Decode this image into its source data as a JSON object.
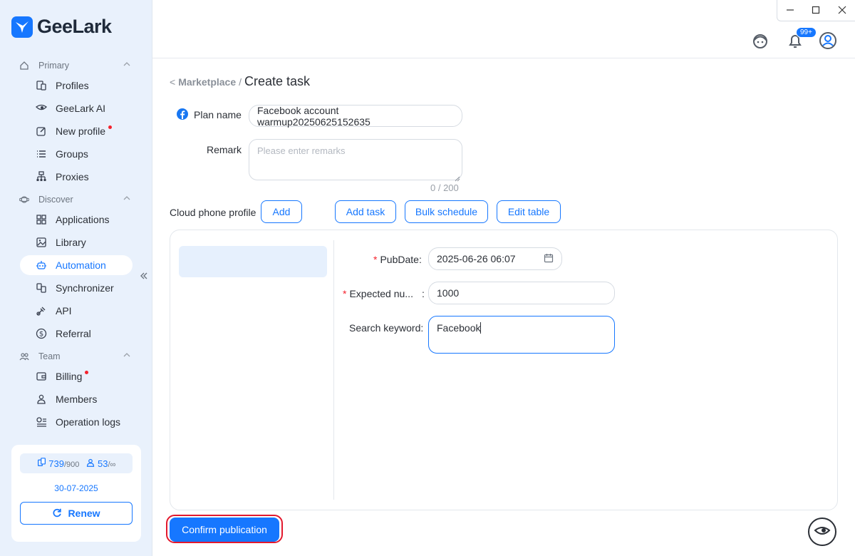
{
  "app": {
    "name": "GeeLark",
    "colors": {
      "accent": "#1677ff",
      "sidebar_bg": "#e9f1fc",
      "danger": "#f5222d"
    }
  },
  "sidebar": {
    "sections": [
      {
        "title": "Primary",
        "icon": "home-icon",
        "items": [
          {
            "label": "Profiles",
            "icon": "profiles-icon"
          },
          {
            "label": "GeeLark AI",
            "icon": "ai-eye-icon"
          },
          {
            "label": "New profile",
            "icon": "edit-icon",
            "dot": true
          },
          {
            "label": "Groups",
            "icon": "list-icon"
          },
          {
            "label": "Proxies",
            "icon": "network-icon"
          }
        ]
      },
      {
        "title": "Discover",
        "icon": "planet-icon",
        "items": [
          {
            "label": "Applications",
            "icon": "grid-icon"
          },
          {
            "label": "Library",
            "icon": "image-library-icon"
          },
          {
            "label": "Automation",
            "icon": "robot-icon",
            "active": true
          },
          {
            "label": "Synchronizer",
            "icon": "sync-icon"
          },
          {
            "label": "API",
            "icon": "api-icon"
          },
          {
            "label": "Referral",
            "icon": "dollar-icon"
          }
        ]
      },
      {
        "title": "Team",
        "icon": "team-icon",
        "items": [
          {
            "label": "Billing",
            "icon": "wallet-icon",
            "dot": true
          },
          {
            "label": "Members",
            "icon": "user-icon"
          },
          {
            "label": "Operation logs",
            "icon": "logs-icon"
          }
        ]
      }
    ],
    "quota": {
      "phones_used": "739",
      "phones_total": "/900",
      "members_used": "53",
      "members_total": "/∞",
      "expiry_date": "30-07-2025",
      "renew_label": "Renew"
    }
  },
  "topbar": {
    "notification_badge": "99+"
  },
  "breadcrumb": {
    "back": "<",
    "parent": "Marketplace",
    "separator": "/",
    "current": "Create task"
  },
  "form": {
    "plan_name_label": "Plan name",
    "plan_name_value": "Facebook account warmup20250625152635",
    "remark_label": "Remark",
    "remark_placeholder": "Please enter remarks",
    "remark_counter": "0 / 200",
    "cloud_phone_label": "Cloud phone profile",
    "add_label": "Add",
    "add_task_label": "Add task",
    "bulk_schedule_label": "Bulk schedule",
    "edit_table_label": "Edit table"
  },
  "task_params": {
    "pubdate_label": "PubDate",
    "pubdate_value": "2025-06-26 06:07",
    "expected_label": "Expected nu...",
    "expected_value": "1000",
    "keyword_label": "Search keyword",
    "keyword_value": "Facebook",
    "colon": ":",
    "required_mark": "*"
  },
  "footer": {
    "confirm_label": "Confirm publication"
  }
}
